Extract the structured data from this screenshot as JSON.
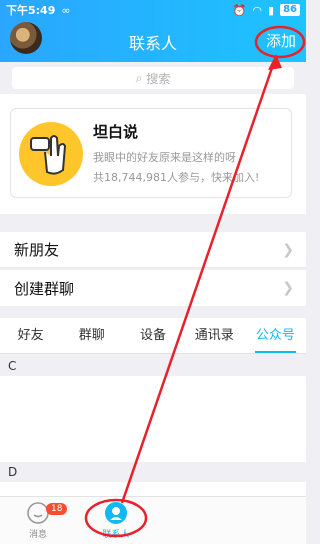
{
  "status": {
    "time": "下午5:49",
    "battery": "86"
  },
  "header": {
    "title": "联系人",
    "add_label": "添加"
  },
  "search": {
    "placeholder": "搜索"
  },
  "card": {
    "title": "坦白说",
    "line1": "我眼中的好友原来是这样的呀",
    "line2": "共18,744,981人参与，快来加入!"
  },
  "rows": [
    {
      "label": "新朋友"
    },
    {
      "label": "创建群聊"
    }
  ],
  "tabs": [
    "好友",
    "群聊",
    "设备",
    "通讯录",
    "公众号"
  ],
  "active_tab": "公众号",
  "sections": [
    {
      "letter": "C"
    },
    {
      "letter": "D"
    }
  ],
  "bottom_nav": {
    "messages_label": "消息",
    "messages_badge": "18",
    "contacts_label": "联系人"
  },
  "colors": {
    "header_start": "#2aa6ff",
    "header_end": "#1ec3ff",
    "accent": "#12b7f5",
    "annotation": "#e8212b",
    "badge": "#f74c31"
  }
}
